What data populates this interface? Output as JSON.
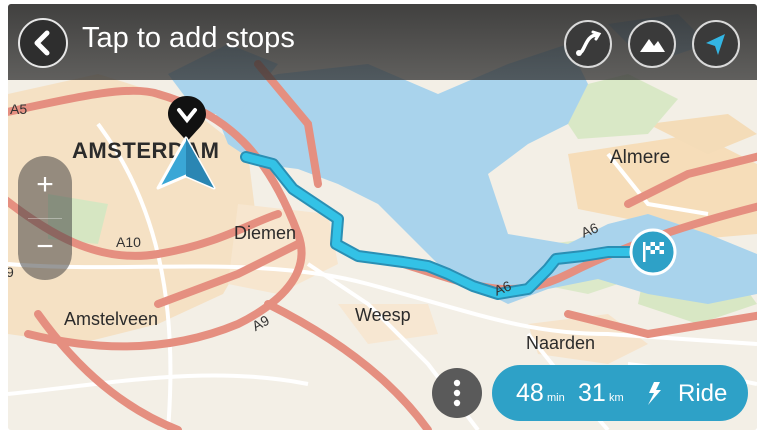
{
  "topbar": {
    "title": "Tap to add stops",
    "icons": [
      "route-icon",
      "terrain-icon",
      "location-arrow-icon"
    ]
  },
  "map": {
    "cities": [
      {
        "id": "amsterdam",
        "label": "AMSTERDAM"
      },
      {
        "id": "almere",
        "label": "Almere"
      },
      {
        "id": "diemen",
        "label": "Diemen"
      },
      {
        "id": "weesp",
        "label": "Weesp"
      },
      {
        "id": "amstelveen",
        "label": "Amstelveen"
      },
      {
        "id": "naarden",
        "label": "Naarden"
      }
    ],
    "roads": [
      "A5",
      "A10",
      "A9",
      "A6",
      "A6",
      "9"
    ]
  },
  "zoom": {
    "in_label": "+",
    "out_label": "−"
  },
  "ride_bar": {
    "duration_value": "48",
    "duration_unit": "min",
    "distance_value": "31",
    "distance_unit": "km",
    "action_label": "Ride"
  },
  "colors": {
    "route": "#33c2e6",
    "water": "#a9d3ec",
    "motorway": "#e58f80",
    "ride_bar": "#2ea1c7",
    "position_marker": "#3aa7d6"
  }
}
